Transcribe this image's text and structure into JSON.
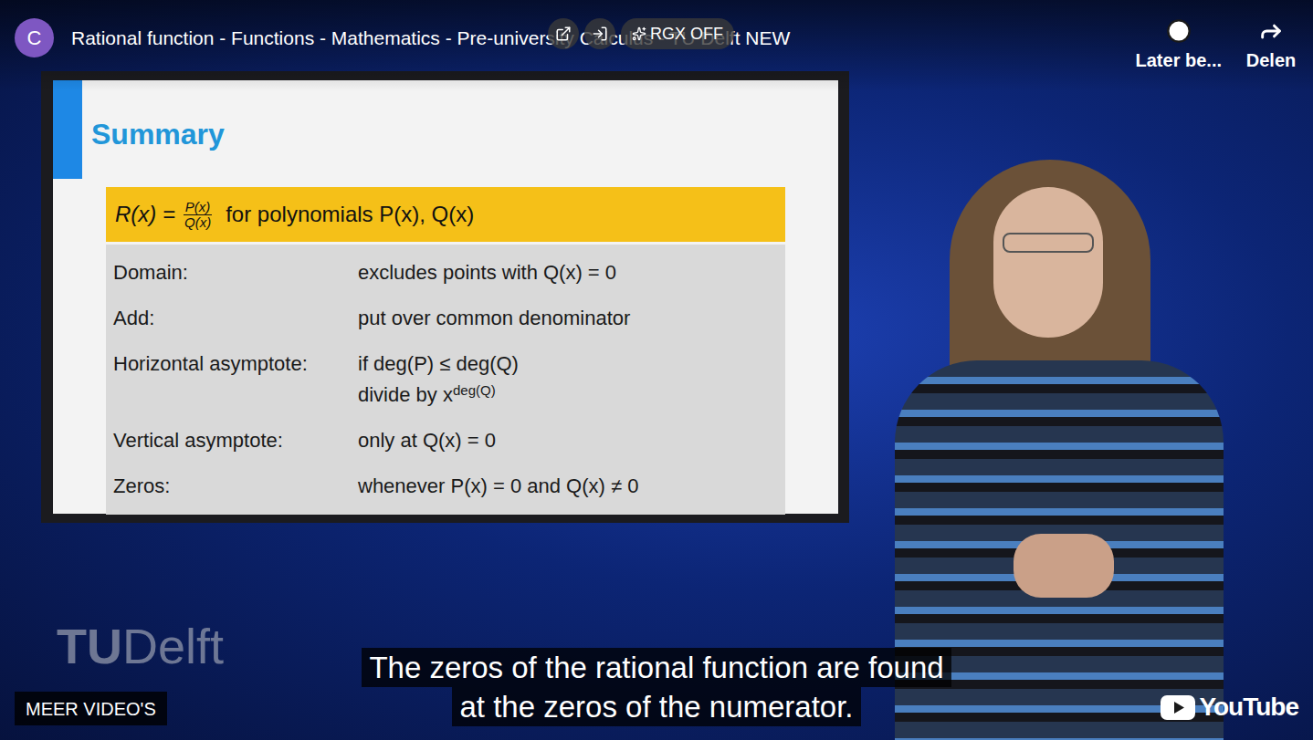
{
  "player": {
    "channel_avatar": "C",
    "title": "Rational function - Functions - Mathematics - Pre-university Calculus - TU Delft NEW",
    "extension": {
      "label": "RGX OFF"
    },
    "actions": [
      {
        "kind": "watch-later",
        "label": "Later be..."
      },
      {
        "kind": "share",
        "label": "Delen"
      }
    ],
    "more_videos": "MEER VIDEO'S",
    "logo": "YouTube"
  },
  "slide": {
    "title": "Summary",
    "definition": {
      "lhs": "R(x) =",
      "numerator": "P(x)",
      "denominator": "Q(x)",
      "text": "for polynomials P(x), Q(x)"
    },
    "rows": [
      {
        "label": "Domain:",
        "lines": [
          {
            "text": "excludes points with Q(x) = 0"
          }
        ]
      },
      {
        "label": "Add:",
        "lines": [
          {
            "text": "put over common denominator"
          }
        ]
      },
      {
        "label": "Horizontal asymptote:",
        "lines": [
          {
            "text": "if deg(P) ≤ deg(Q)"
          },
          {
            "text": "divide by x",
            "sup": "deg(Q)"
          }
        ]
      },
      {
        "label": "Vertical asymptote:",
        "lines": [
          {
            "text": "only at Q(x) = 0"
          }
        ]
      },
      {
        "label": "Zeros:",
        "lines": [
          {
            "text": "whenever P(x) = 0 and Q(x) ≠ 0"
          }
        ]
      }
    ]
  },
  "watermark": {
    "bold": "TU",
    "light": "Delft"
  },
  "captions": [
    "The zeros of the rational function are found",
    "at the zeros of the numerator."
  ]
}
